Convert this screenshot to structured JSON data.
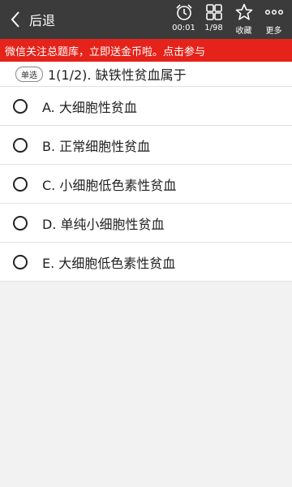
{
  "header": {
    "back_label": "后退",
    "timer": "00:01",
    "progress": "1/98",
    "favorite_label": "收藏",
    "more_label": "更多"
  },
  "banner": {
    "text": "微信关注总题库，立即送金币啦。点击参与",
    "color": "#e5231a"
  },
  "question": {
    "type_tag": "单选",
    "text": "1(1/2). 缺铁性贫血属于",
    "options": [
      "A. 大细胞性贫血",
      "B. 正常细胞性贫血",
      "C. 小细胞低色素性贫血",
      "D. 单纯小细胞性贫血",
      "E. 大细胞低色素性贫血"
    ]
  }
}
